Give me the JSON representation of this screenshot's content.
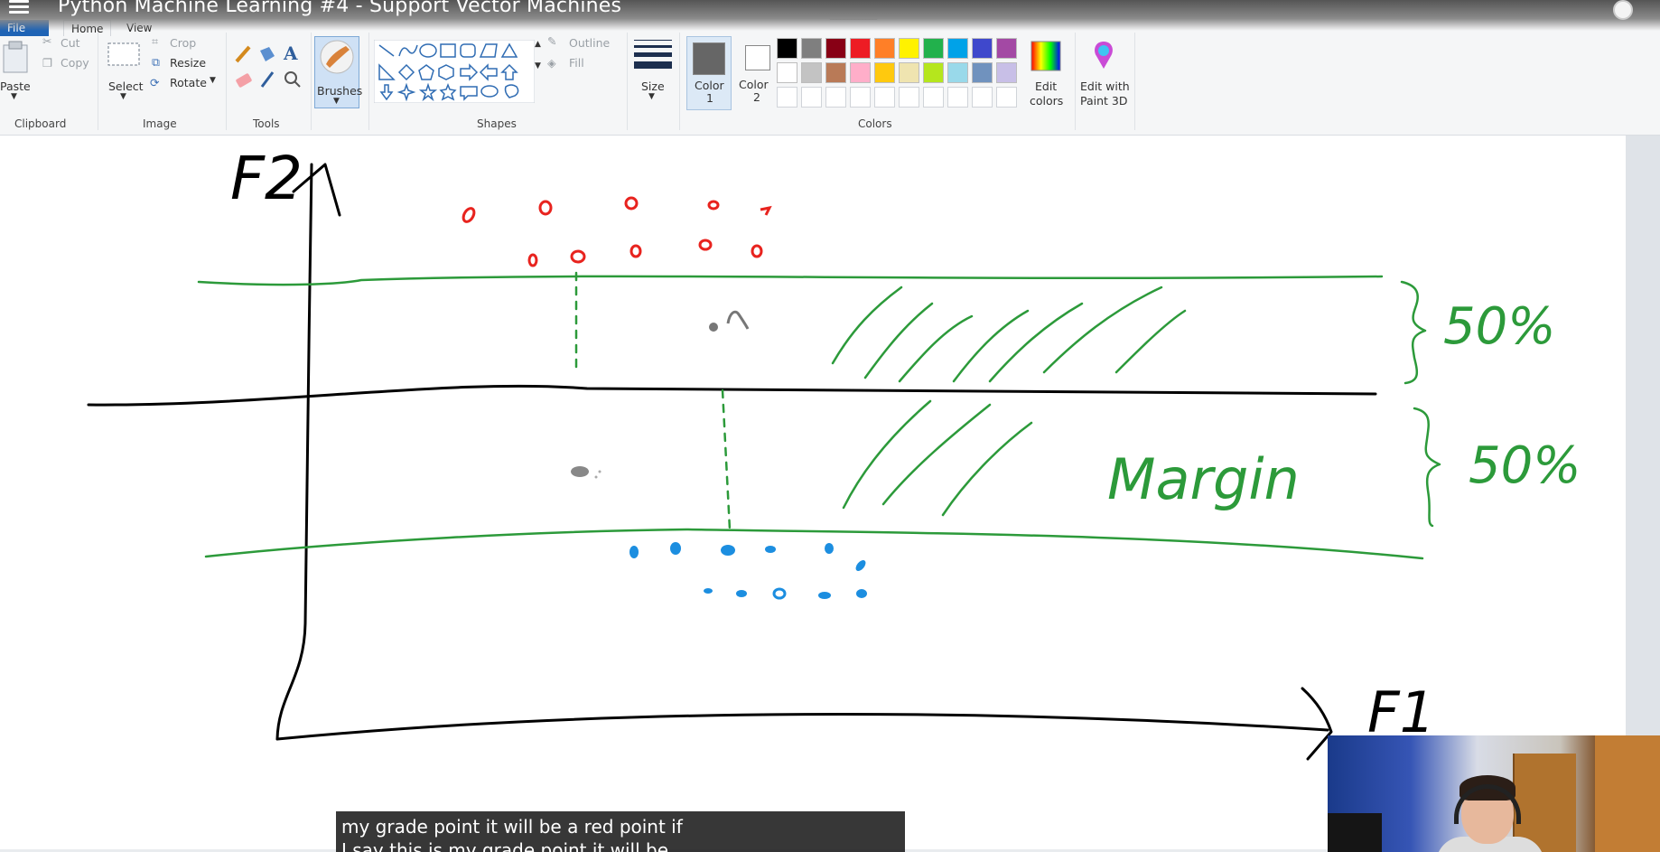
{
  "video": {
    "title": "Python Machine Learning #4 - Support Vector Machines",
    "close_symbol": "✕",
    "subtitles": [
      "my grade point it will be a red point if",
      "I say this is my grade point it will be"
    ]
  },
  "paint": {
    "tabs": {
      "file": "File",
      "home": "Home",
      "view": "View"
    },
    "clipboard": {
      "label": "Clipboard",
      "paste": "Paste",
      "cut": "Cut",
      "copy": "Copy"
    },
    "image": {
      "label": "Image",
      "select": "Select",
      "crop": "Crop",
      "resize": "Resize",
      "rotate": "Rotate"
    },
    "tools": {
      "label": "Tools"
    },
    "brushes": {
      "label": "Brushes"
    },
    "shapes": {
      "label": "Shapes",
      "outline": "Outline",
      "fill": "Fill"
    },
    "size": {
      "label": "Size"
    },
    "color1": {
      "label": "Color",
      "num": "1",
      "value": "#666666"
    },
    "color2": {
      "label": "Color",
      "num": "2",
      "value": "#ffffff"
    },
    "colors": {
      "label": "Colors",
      "row1": [
        "#000000",
        "#7f7f7f",
        "#880015",
        "#ed1c24",
        "#ff7f27",
        "#fff200",
        "#22b14c",
        "#00a2e8",
        "#3f48cc",
        "#a349a4"
      ],
      "row2": [
        "#ffffff",
        "#c3c3c3",
        "#b97a57",
        "#ffaec9",
        "#ffc90e",
        "#efe4b0",
        "#b5e61d",
        "#99d9ea",
        "#7092be",
        "#c8bfe7"
      ],
      "row3": [
        "#ffffff",
        "#ffffff",
        "#ffffff",
        "#ffffff",
        "#ffffff",
        "#ffffff",
        "#ffffff",
        "#ffffff",
        "#ffffff",
        "#ffffff"
      ]
    },
    "edit_colors": {
      "line1": "Edit",
      "line2": "colors"
    },
    "paint3d": {
      "line1": "Edit with",
      "line2": "Paint 3D"
    }
  },
  "drawing": {
    "ylabel": "F2",
    "xlabel": "F1",
    "margin_label": "Margin",
    "top_percent": "50%",
    "bottom_percent": "50%",
    "class_colors": {
      "red": "#e8231e",
      "blue": "#1c8ee0",
      "green": "#2c9a3a",
      "black": "#000000",
      "gray": "#777777"
    }
  }
}
